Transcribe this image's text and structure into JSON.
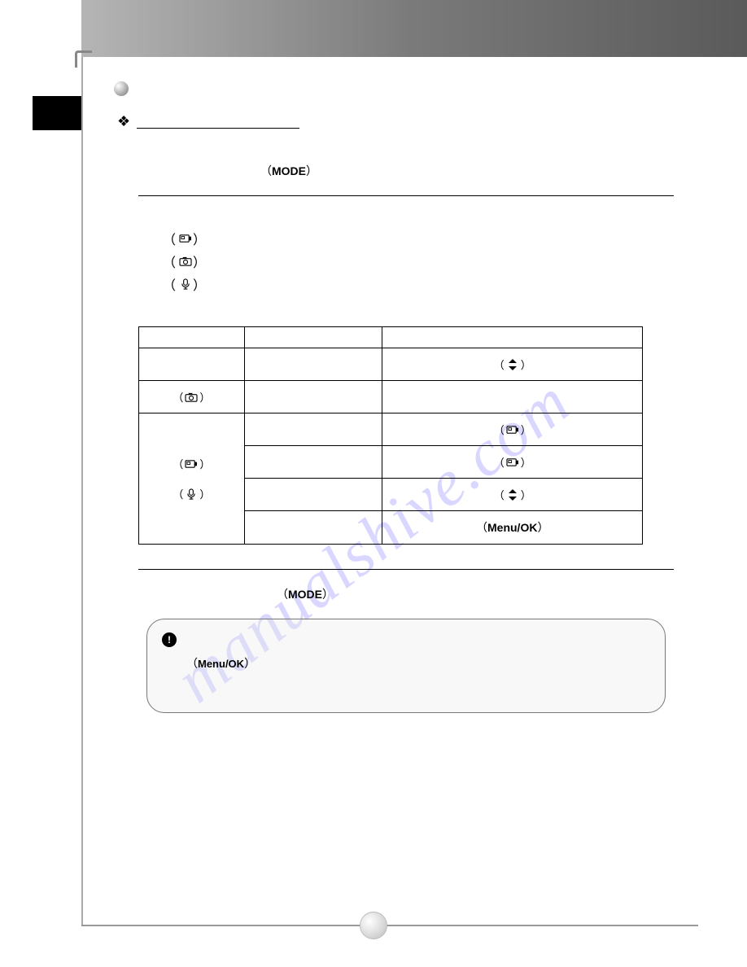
{
  "section_title": "",
  "subsection_title": "",
  "mode_label": "MODE",
  "icons": {
    "video": "video-camera-icon",
    "photo": "photo-camera-icon",
    "mic": "microphone-icon",
    "updown": "up-down-arrow-icon"
  },
  "table": {
    "header": [
      "",
      "",
      ""
    ],
    "rows": [
      {
        "c1": "",
        "c2": "",
        "c3_icon": "updown"
      },
      {
        "c1_icon": "photo",
        "c2": "",
        "c3": ""
      },
      {
        "c1_merge_start": true,
        "c2": "",
        "c3_icon": "video"
      },
      {
        "c2_icon_a": "video",
        "c2_label": "",
        "c3_icon": "video"
      },
      {
        "c2_icon_b": "mic",
        "c3_icon": "updown"
      },
      {
        "c2": "",
        "c3_label": "Menu/OK"
      }
    ]
  },
  "note": {
    "label": "Menu/OK"
  },
  "watermark": "manualshive.com",
  "page_number": ""
}
